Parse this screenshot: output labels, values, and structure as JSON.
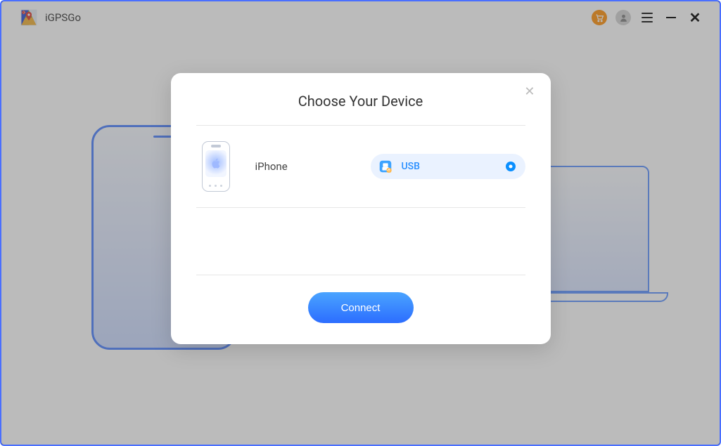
{
  "app": {
    "name": "iGPSGo"
  },
  "modal": {
    "title": "Choose Your Device",
    "device": {
      "name": "iPhone",
      "connection_type": "USB"
    },
    "connect_label": "Connect"
  },
  "icons": {
    "cart": "cart-icon",
    "user": "user-icon",
    "menu": "hamburger-icon",
    "minimize": "minimize-icon",
    "close": "close-icon"
  },
  "colors": {
    "accent_border": "#4a6fff",
    "button_gradient_start": "#4aa4ff",
    "button_gradient_end": "#2c6dff",
    "pill_bg": "#eaf2ff",
    "radio_fill": "#0a8fff",
    "cart_bg": "#ff9a1f"
  }
}
